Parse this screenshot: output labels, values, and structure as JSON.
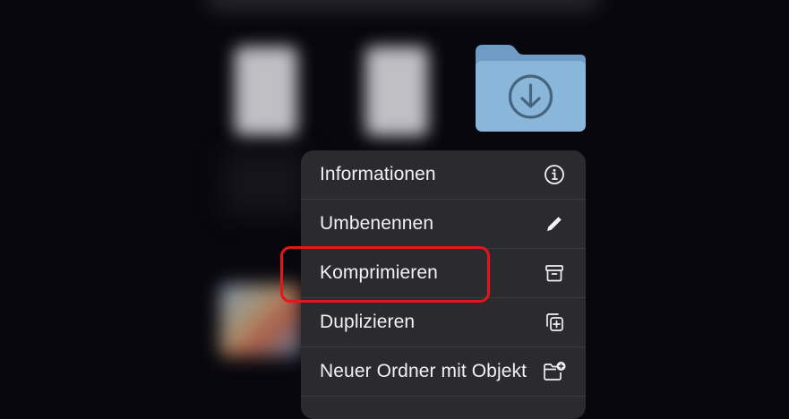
{
  "colors": {
    "background": "#07070d",
    "menu_background": "#2b2b2f",
    "menu_divider": "#3b3b40",
    "menu_text": "#f2f2f5",
    "folder_blue": "#8ab6d9",
    "highlight": "#e4161b"
  },
  "folder": {
    "icon": "download-folder-icon"
  },
  "menu": {
    "items": [
      {
        "label": "Informationen",
        "icon": "info-circle-icon"
      },
      {
        "label": "Umbenennen",
        "icon": "pencil-icon"
      },
      {
        "label": "Komprimieren",
        "icon": "archive-box-icon"
      },
      {
        "label": "Duplizieren",
        "icon": "duplicate-plus-icon"
      },
      {
        "label": "Neuer Ordner mit Objekt",
        "icon": "folder-plus-icon"
      }
    ]
  }
}
